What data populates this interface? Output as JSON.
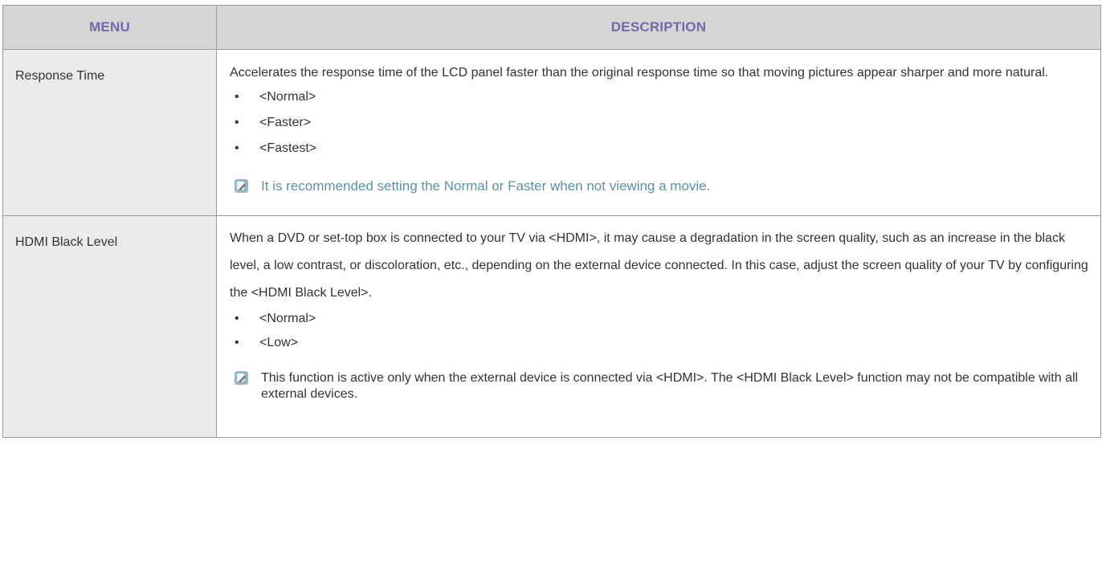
{
  "table": {
    "headers": {
      "menu": "MENU",
      "description": "DESCRIPTION"
    },
    "rows": [
      {
        "menu": "Response Time",
        "description": "Accelerates the response time of the LCD panel faster than the original response time so that moving pictures appear sharper and more natural.",
        "options": [
          "<Normal>",
          "<Faster>",
          "<Fastest>"
        ],
        "note": "It is recommended setting the Normal or Faster when not viewing a movie."
      },
      {
        "menu": "HDMI Black Level",
        "description": "When a DVD or set-top box is connected to your TV via <HDMI>, it may cause a degradation in the screen quality, such as an increase in the black level, a low contrast, or discoloration, etc., depending on the external device connected. In this case, adjust the screen quality of your TV by configuring the <HDMI Black Level>.",
        "options": [
          "<Normal>",
          "<Low>"
        ],
        "note": "This function is active only when the external device is connected via <HDMI>. The <HDMI Black Level> function may not be compatible with all external devices."
      }
    ]
  },
  "bullet_glyph": "•",
  "icons": {
    "note": "note-pencil-icon"
  },
  "colors": {
    "header_text": "#6f6aa8",
    "header_bg": "#d5d5d5",
    "menu_cell_bg": "#ebebeb",
    "note_highlight_text": "#5f8fa6",
    "note_icon_bg": "#9bb7c2",
    "border": "#9a9a9a"
  }
}
